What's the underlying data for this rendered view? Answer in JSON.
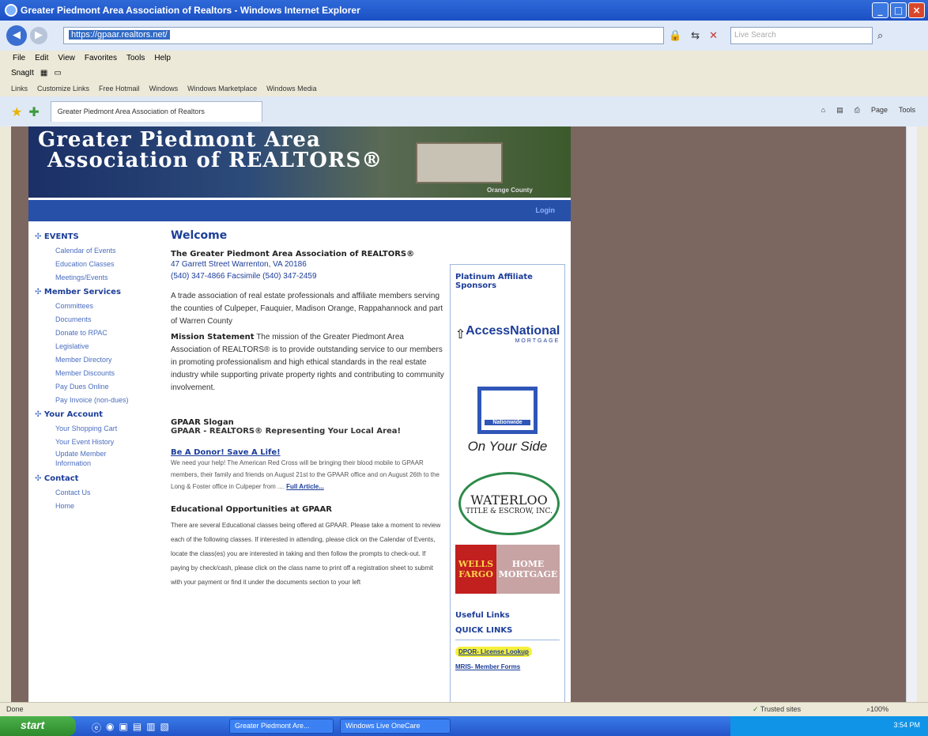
{
  "window": {
    "title": "Greater Piedmont Area Association of Realtors - Windows Internet Explorer"
  },
  "address": {
    "url": "https://gpaar.realtors.net/",
    "search_placeholder": "Live Search"
  },
  "menus": [
    "File",
    "Edit",
    "View",
    "Favorites",
    "Tools",
    "Help"
  ],
  "snagit": {
    "label": "SnagIt"
  },
  "links_bar": [
    "Links",
    "Customize Links",
    "Free Hotmail",
    "Windows",
    "Windows Marketplace",
    "Windows Media"
  ],
  "tab": {
    "label": "Greater Piedmont Area Association of Realtors",
    "page_label": "Page",
    "tools_label": "Tools"
  },
  "site": {
    "banner_line1": "Greater Piedmont Area",
    "banner_line2": "Association of REALTORS®",
    "banner_caption": "Orange County",
    "login_label": "Login",
    "nav": {
      "events": {
        "heading": "EVENTS",
        "items": [
          "Calendar of Events",
          "Education Classes",
          "Meetings/Events"
        ]
      },
      "member": {
        "heading": "Member Services",
        "items": [
          "Committees",
          "Documents",
          "Donate to RPAC",
          "Legislative",
          "Member Directory",
          "Member Discounts",
          "Pay Dues Online",
          "Pay Invoice (non-dues)"
        ]
      },
      "account": {
        "heading": "Your Account",
        "items": [
          "Your Shopping Cart",
          "Your Event History",
          "Update Member",
          "Information"
        ]
      },
      "contact": {
        "heading": "Contact",
        "items": [
          "Contact Us",
          "Home"
        ]
      }
    },
    "main": {
      "welcome": "Welcome",
      "org_name": "The Greater Piedmont Area Association of REALTORS®",
      "address_line": "47 Garrett Street Warrenton, VA 20186",
      "phone_line": "(540) 347-4866 Facsimile (540) 347-2459",
      "trade_paragraph": "A trade association of real estate professionals and affiliate members serving the counties of Culpeper, Fauquier, Madison Orange, Rappahannock and part of Warren County",
      "mission_heading": "Mission Statement",
      "mission_text": "The mission of the Greater Piedmont Area Association of REALTORS® is to provide outstanding service to our members in promoting professionalism and high ethical standards in the real estate industry while supporting private property rights and contributing to community involvement.",
      "slogan_heading": "GPAAR Slogan",
      "slogan_text": "GPAAR - REALTORS® Representing Your Local Area!",
      "donor_title": "Be A Donor! Save A Life!",
      "donor_text": "We need your help! The American Red Cross will be bringing their blood mobile to GPAAR members, their family and friends on August 21st to the GPAAR office and on August 26th to the Long & Foster office in Culpeper from ....",
      "full_article": "Full Article...",
      "edu_heading": "Educational Opportunities at GPAAR",
      "edu_text": "There are several Educational classes being offered at GPAAR. Please take a moment to review each of the following classes. If interested in attending, please click on the Calendar of Events, locate the class(es) you are interested in taking and then follow the prompts to check-out. If paying by check/cash, please click on the class name to print off a registration sheet to submit with your payment or find it under the documents section to your left"
    },
    "sidebar": {
      "sponsors_heading": "Platinum Affiliate Sponsors",
      "access_national": "AccessNational",
      "access_sub": "MORTGAGE",
      "nationwide": "Nationwide",
      "on_your_side": "On Your Side",
      "waterloo1": "WATERLOO",
      "waterloo2": "TITLE & ESCROW, INC.",
      "wells": "WELLS FARGO",
      "home_mortgage": "HOME MORTGAGE",
      "useful_links": "Useful Links",
      "quick_links": "QUICK LINKS",
      "link1": "DPOR- License Lookup",
      "link2": "MRIS- Member Forms"
    }
  },
  "status": {
    "left": "Done",
    "trusted": "Trusted sites",
    "zoom": "100%"
  },
  "taskbar": {
    "start": "start",
    "task1": "Greater Piedmont Are...",
    "task2": "Windows Live OneCare",
    "clock": "3:54 PM"
  },
  "colors": {
    "title_blue": "#1c3d99",
    "link_blue": "#4a6dbf",
    "nav_bar": "#2751a8",
    "highlight": "#f5f03a"
  }
}
